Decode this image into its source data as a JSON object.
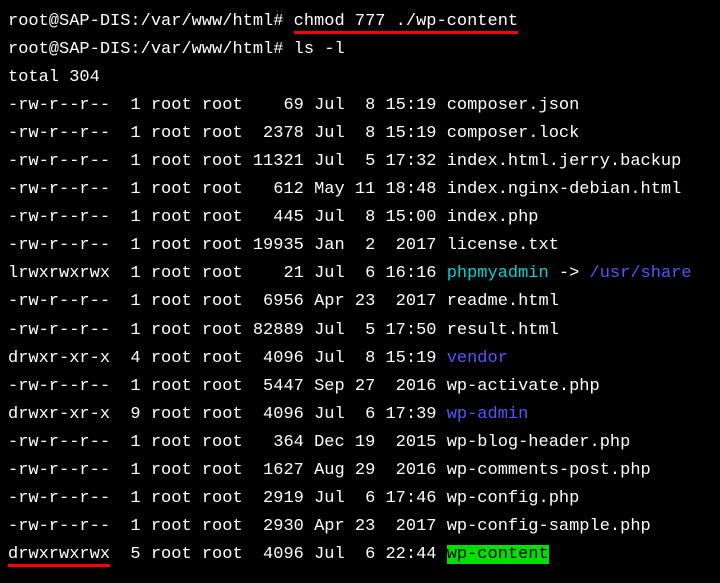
{
  "prompt1": {
    "user_host": "root@SAP-DIS",
    "path": ":/var/www/html# ",
    "command": "chmod 777 ./wp-content"
  },
  "prompt2": {
    "user_host": "root@SAP-DIS",
    "path": ":/var/www/html# ",
    "command": "ls -l"
  },
  "total": "total 304",
  "files": [
    {
      "perm": "-rw-r--r--",
      "ln": "1",
      "own": "root",
      "grp": "root",
      "size": "   69",
      "mon": "Jul",
      "day": " 8",
      "time": "15:19",
      "name": "composer.json",
      "type": "file"
    },
    {
      "perm": "-rw-r--r--",
      "ln": "1",
      "own": "root",
      "grp": "root",
      "size": " 2378",
      "mon": "Jul",
      "day": " 8",
      "time": "15:19",
      "name": "composer.lock",
      "type": "file"
    },
    {
      "perm": "-rw-r--r--",
      "ln": "1",
      "own": "root",
      "grp": "root",
      "size": "11321",
      "mon": "Jul",
      "day": " 5",
      "time": "17:32",
      "name": "index.html.jerry.backup",
      "type": "file"
    },
    {
      "perm": "-rw-r--r--",
      "ln": "1",
      "own": "root",
      "grp": "root",
      "size": "  612",
      "mon": "May",
      "day": "11",
      "time": "18:48",
      "name": "index.nginx-debian.html",
      "type": "file"
    },
    {
      "perm": "-rw-r--r--",
      "ln": "1",
      "own": "root",
      "grp": "root",
      "size": "  445",
      "mon": "Jul",
      "day": " 8",
      "time": "15:00",
      "name": "index.php",
      "type": "file"
    },
    {
      "perm": "-rw-r--r--",
      "ln": "1",
      "own": "root",
      "grp": "root",
      "size": "19935",
      "mon": "Jan",
      "day": " 2",
      "time": " 2017",
      "name": "license.txt",
      "type": "file"
    },
    {
      "perm": "lrwxrwxrwx",
      "ln": "1",
      "own": "root",
      "grp": "root",
      "size": "   21",
      "mon": "Jul",
      "day": " 6",
      "time": "16:16",
      "name": "phpmyadmin",
      "type": "link",
      "target": "/usr/share"
    },
    {
      "perm": "-rw-r--r--",
      "ln": "1",
      "own": "root",
      "grp": "root",
      "size": " 6956",
      "mon": "Apr",
      "day": "23",
      "time": " 2017",
      "name": "readme.html",
      "type": "file"
    },
    {
      "perm": "-rw-r--r--",
      "ln": "1",
      "own": "root",
      "grp": "root",
      "size": "82889",
      "mon": "Jul",
      "day": " 5",
      "time": "17:50",
      "name": "result.html",
      "type": "file"
    },
    {
      "perm": "drwxr-xr-x",
      "ln": "4",
      "own": "root",
      "grp": "root",
      "size": " 4096",
      "mon": "Jul",
      "day": " 8",
      "time": "15:19",
      "name": "vendor",
      "type": "dir"
    },
    {
      "perm": "-rw-r--r--",
      "ln": "1",
      "own": "root",
      "grp": "root",
      "size": " 5447",
      "mon": "Sep",
      "day": "27",
      "time": " 2016",
      "name": "wp-activate.php",
      "type": "file"
    },
    {
      "perm": "drwxr-xr-x",
      "ln": "9",
      "own": "root",
      "grp": "root",
      "size": " 4096",
      "mon": "Jul",
      "day": " 6",
      "time": "17:39",
      "name": "wp-admin",
      "type": "dir"
    },
    {
      "perm": "-rw-r--r--",
      "ln": "1",
      "own": "root",
      "grp": "root",
      "size": "  364",
      "mon": "Dec",
      "day": "19",
      "time": " 2015",
      "name": "wp-blog-header.php",
      "type": "file"
    },
    {
      "perm": "-rw-r--r--",
      "ln": "1",
      "own": "root",
      "grp": "root",
      "size": " 1627",
      "mon": "Aug",
      "day": "29",
      "time": " 2016",
      "name": "wp-comments-post.php",
      "type": "file"
    },
    {
      "perm": "-rw-r--r--",
      "ln": "1",
      "own": "root",
      "grp": "root",
      "size": " 2919",
      "mon": "Jul",
      "day": " 6",
      "time": "17:46",
      "name": "wp-config.php",
      "type": "file"
    },
    {
      "perm": "-rw-r--r--",
      "ln": "1",
      "own": "root",
      "grp": "root",
      "size": " 2930",
      "mon": "Apr",
      "day": "23",
      "time": " 2017",
      "name": "wp-config-sample.php",
      "type": "file"
    },
    {
      "perm": "drwxrwxrwx",
      "ln": "5",
      "own": "root",
      "grp": "root",
      "size": " 4096",
      "mon": "Jul",
      "day": " 6",
      "time": "22:44",
      "name": "wp-content",
      "type": "dir",
      "highlightGreen": true,
      "permUnderline": true
    }
  ]
}
